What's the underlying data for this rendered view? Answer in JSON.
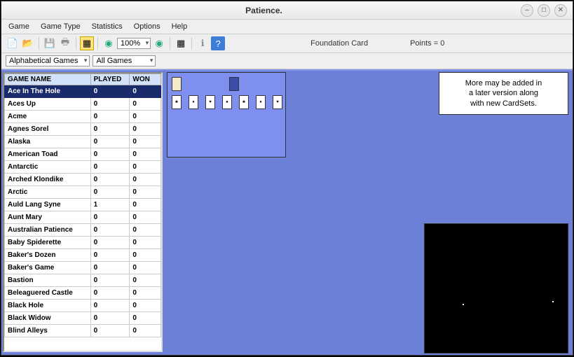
{
  "window": {
    "title": "Patience."
  },
  "win_buttons": {
    "min": "–",
    "max": "□",
    "close": "✕"
  },
  "menu": [
    "Game",
    "Game Type",
    "Statistics",
    "Options",
    "Help"
  ],
  "toolbar": {
    "zoom": "100%",
    "status_foundation": "Foundation Card",
    "status_points": "Points = 0"
  },
  "filters": {
    "sort": "Alphabetical Games",
    "filter": "All Games"
  },
  "table": {
    "headers": [
      "GAME NAME",
      "PLAYED",
      "WON"
    ],
    "rows": [
      {
        "name": "Ace In The Hole",
        "played": "0",
        "won": "0",
        "selected": true
      },
      {
        "name": "Aces Up",
        "played": "0",
        "won": "0"
      },
      {
        "name": "Acme",
        "played": "0",
        "won": "0"
      },
      {
        "name": "Agnes Sorel",
        "played": "0",
        "won": "0"
      },
      {
        "name": "Alaska",
        "played": "0",
        "won": "0"
      },
      {
        "name": "American Toad",
        "played": "0",
        "won": "0"
      },
      {
        "name": "Antarctic",
        "played": "0",
        "won": "0"
      },
      {
        "name": "Arched Klondike",
        "played": "0",
        "won": "0"
      },
      {
        "name": "Arctic",
        "played": "0",
        "won": "0"
      },
      {
        "name": "Auld Lang Syne",
        "played": "1",
        "won": "0"
      },
      {
        "name": "Aunt Mary",
        "played": "0",
        "won": "0"
      },
      {
        "name": "Australian Patience",
        "played": "0",
        "won": "0"
      },
      {
        "name": "Baby Spiderette",
        "played": "0",
        "won": "0"
      },
      {
        "name": "Baker's Dozen",
        "played": "0",
        "won": "0"
      },
      {
        "name": "Baker's Game",
        "played": "0",
        "won": "0"
      },
      {
        "name": "Bastion",
        "played": "0",
        "won": "0"
      },
      {
        "name": "Beleaguered Castle",
        "played": "0",
        "won": "0"
      },
      {
        "name": "Black Hole",
        "played": "0",
        "won": "0"
      },
      {
        "name": "Black Widow",
        "played": "0",
        "won": "0"
      },
      {
        "name": "Blind Alleys",
        "played": "0",
        "won": "0"
      }
    ]
  },
  "info": {
    "line1": "More may be added in",
    "line2": "a later version along",
    "line3": "with new CardSets."
  }
}
